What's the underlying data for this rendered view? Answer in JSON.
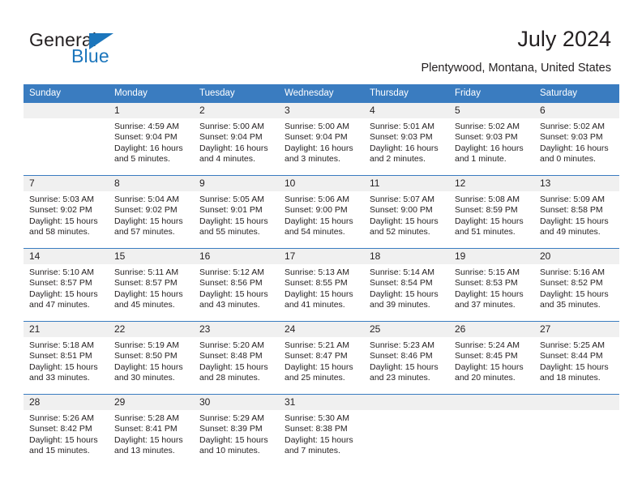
{
  "brand": {
    "name_part1": "General",
    "name_part2": "Blue",
    "accent_color": "#1c76bc"
  },
  "header": {
    "title": "July 2024",
    "subtitle": "Plentywood, Montana, United States"
  },
  "calendar": {
    "header_color": "#3a7cc0",
    "weekdays": [
      "Sunday",
      "Monday",
      "Tuesday",
      "Wednesday",
      "Thursday",
      "Friday",
      "Saturday"
    ],
    "weeks": [
      [
        {
          "day": "",
          "sunrise": "",
          "sunset": "",
          "daylight_line1": "",
          "daylight_line2": ""
        },
        {
          "day": "1",
          "sunrise": "Sunrise: 4:59 AM",
          "sunset": "Sunset: 9:04 PM",
          "daylight_line1": "Daylight: 16 hours",
          "daylight_line2": "and 5 minutes."
        },
        {
          "day": "2",
          "sunrise": "Sunrise: 5:00 AM",
          "sunset": "Sunset: 9:04 PM",
          "daylight_line1": "Daylight: 16 hours",
          "daylight_line2": "and 4 minutes."
        },
        {
          "day": "3",
          "sunrise": "Sunrise: 5:00 AM",
          "sunset": "Sunset: 9:04 PM",
          "daylight_line1": "Daylight: 16 hours",
          "daylight_line2": "and 3 minutes."
        },
        {
          "day": "4",
          "sunrise": "Sunrise: 5:01 AM",
          "sunset": "Sunset: 9:03 PM",
          "daylight_line1": "Daylight: 16 hours",
          "daylight_line2": "and 2 minutes."
        },
        {
          "day": "5",
          "sunrise": "Sunrise: 5:02 AM",
          "sunset": "Sunset: 9:03 PM",
          "daylight_line1": "Daylight: 16 hours",
          "daylight_line2": "and 1 minute."
        },
        {
          "day": "6",
          "sunrise": "Sunrise: 5:02 AM",
          "sunset": "Sunset: 9:03 PM",
          "daylight_line1": "Daylight: 16 hours",
          "daylight_line2": "and 0 minutes."
        }
      ],
      [
        {
          "day": "7",
          "sunrise": "Sunrise: 5:03 AM",
          "sunset": "Sunset: 9:02 PM",
          "daylight_line1": "Daylight: 15 hours",
          "daylight_line2": "and 58 minutes."
        },
        {
          "day": "8",
          "sunrise": "Sunrise: 5:04 AM",
          "sunset": "Sunset: 9:02 PM",
          "daylight_line1": "Daylight: 15 hours",
          "daylight_line2": "and 57 minutes."
        },
        {
          "day": "9",
          "sunrise": "Sunrise: 5:05 AM",
          "sunset": "Sunset: 9:01 PM",
          "daylight_line1": "Daylight: 15 hours",
          "daylight_line2": "and 55 minutes."
        },
        {
          "day": "10",
          "sunrise": "Sunrise: 5:06 AM",
          "sunset": "Sunset: 9:00 PM",
          "daylight_line1": "Daylight: 15 hours",
          "daylight_line2": "and 54 minutes."
        },
        {
          "day": "11",
          "sunrise": "Sunrise: 5:07 AM",
          "sunset": "Sunset: 9:00 PM",
          "daylight_line1": "Daylight: 15 hours",
          "daylight_line2": "and 52 minutes."
        },
        {
          "day": "12",
          "sunrise": "Sunrise: 5:08 AM",
          "sunset": "Sunset: 8:59 PM",
          "daylight_line1": "Daylight: 15 hours",
          "daylight_line2": "and 51 minutes."
        },
        {
          "day": "13",
          "sunrise": "Sunrise: 5:09 AM",
          "sunset": "Sunset: 8:58 PM",
          "daylight_line1": "Daylight: 15 hours",
          "daylight_line2": "and 49 minutes."
        }
      ],
      [
        {
          "day": "14",
          "sunrise": "Sunrise: 5:10 AM",
          "sunset": "Sunset: 8:57 PM",
          "daylight_line1": "Daylight: 15 hours",
          "daylight_line2": "and 47 minutes."
        },
        {
          "day": "15",
          "sunrise": "Sunrise: 5:11 AM",
          "sunset": "Sunset: 8:57 PM",
          "daylight_line1": "Daylight: 15 hours",
          "daylight_line2": "and 45 minutes."
        },
        {
          "day": "16",
          "sunrise": "Sunrise: 5:12 AM",
          "sunset": "Sunset: 8:56 PM",
          "daylight_line1": "Daylight: 15 hours",
          "daylight_line2": "and 43 minutes."
        },
        {
          "day": "17",
          "sunrise": "Sunrise: 5:13 AM",
          "sunset": "Sunset: 8:55 PM",
          "daylight_line1": "Daylight: 15 hours",
          "daylight_line2": "and 41 minutes."
        },
        {
          "day": "18",
          "sunrise": "Sunrise: 5:14 AM",
          "sunset": "Sunset: 8:54 PM",
          "daylight_line1": "Daylight: 15 hours",
          "daylight_line2": "and 39 minutes."
        },
        {
          "day": "19",
          "sunrise": "Sunrise: 5:15 AM",
          "sunset": "Sunset: 8:53 PM",
          "daylight_line1": "Daylight: 15 hours",
          "daylight_line2": "and 37 minutes."
        },
        {
          "day": "20",
          "sunrise": "Sunrise: 5:16 AM",
          "sunset": "Sunset: 8:52 PM",
          "daylight_line1": "Daylight: 15 hours",
          "daylight_line2": "and 35 minutes."
        }
      ],
      [
        {
          "day": "21",
          "sunrise": "Sunrise: 5:18 AM",
          "sunset": "Sunset: 8:51 PM",
          "daylight_line1": "Daylight: 15 hours",
          "daylight_line2": "and 33 minutes."
        },
        {
          "day": "22",
          "sunrise": "Sunrise: 5:19 AM",
          "sunset": "Sunset: 8:50 PM",
          "daylight_line1": "Daylight: 15 hours",
          "daylight_line2": "and 30 minutes."
        },
        {
          "day": "23",
          "sunrise": "Sunrise: 5:20 AM",
          "sunset": "Sunset: 8:48 PM",
          "daylight_line1": "Daylight: 15 hours",
          "daylight_line2": "and 28 minutes."
        },
        {
          "day": "24",
          "sunrise": "Sunrise: 5:21 AM",
          "sunset": "Sunset: 8:47 PM",
          "daylight_line1": "Daylight: 15 hours",
          "daylight_line2": "and 25 minutes."
        },
        {
          "day": "25",
          "sunrise": "Sunrise: 5:23 AM",
          "sunset": "Sunset: 8:46 PM",
          "daylight_line1": "Daylight: 15 hours",
          "daylight_line2": "and 23 minutes."
        },
        {
          "day": "26",
          "sunrise": "Sunrise: 5:24 AM",
          "sunset": "Sunset: 8:45 PM",
          "daylight_line1": "Daylight: 15 hours",
          "daylight_line2": "and 20 minutes."
        },
        {
          "day": "27",
          "sunrise": "Sunrise: 5:25 AM",
          "sunset": "Sunset: 8:44 PM",
          "daylight_line1": "Daylight: 15 hours",
          "daylight_line2": "and 18 minutes."
        }
      ],
      [
        {
          "day": "28",
          "sunrise": "Sunrise: 5:26 AM",
          "sunset": "Sunset: 8:42 PM",
          "daylight_line1": "Daylight: 15 hours",
          "daylight_line2": "and 15 minutes."
        },
        {
          "day": "29",
          "sunrise": "Sunrise: 5:28 AM",
          "sunset": "Sunset: 8:41 PM",
          "daylight_line1": "Daylight: 15 hours",
          "daylight_line2": "and 13 minutes."
        },
        {
          "day": "30",
          "sunrise": "Sunrise: 5:29 AM",
          "sunset": "Sunset: 8:39 PM",
          "daylight_line1": "Daylight: 15 hours",
          "daylight_line2": "and 10 minutes."
        },
        {
          "day": "31",
          "sunrise": "Sunrise: 5:30 AM",
          "sunset": "Sunset: 8:38 PM",
          "daylight_line1": "Daylight: 15 hours",
          "daylight_line2": "and 7 minutes."
        },
        {
          "day": "",
          "sunrise": "",
          "sunset": "",
          "daylight_line1": "",
          "daylight_line2": ""
        },
        {
          "day": "",
          "sunrise": "",
          "sunset": "",
          "daylight_line1": "",
          "daylight_line2": ""
        },
        {
          "day": "",
          "sunrise": "",
          "sunset": "",
          "daylight_line1": "",
          "daylight_line2": ""
        }
      ]
    ]
  }
}
